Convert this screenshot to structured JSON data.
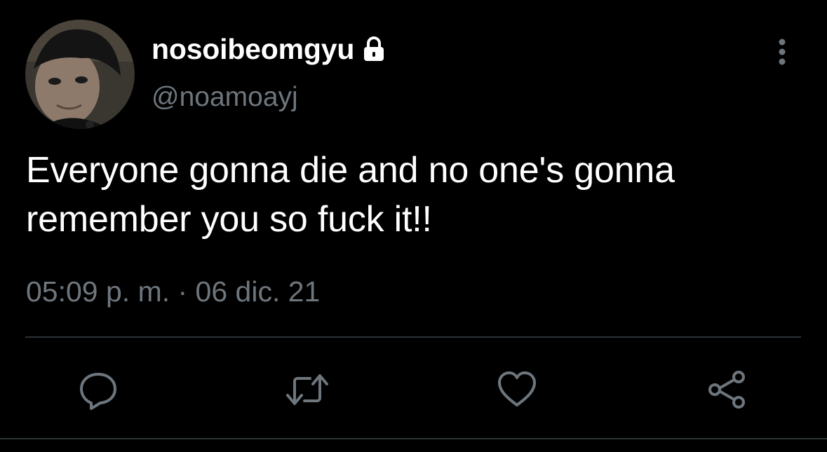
{
  "author": {
    "display_name": "nosoibeomgyu",
    "handle": "@noamoayj",
    "protected": true
  },
  "tweet": {
    "text": "Everyone gonna die and no one's gonna remember you so fuck it!!",
    "timestamp": "05:09 p. m. · 06 dic. 21"
  },
  "actions": {
    "reply_icon": "reply-icon",
    "retweet_icon": "retweet-icon",
    "like_icon": "heart-icon",
    "share_icon": "share-icon"
  },
  "colors": {
    "background": "#000000",
    "primary_text": "#ffffff",
    "secondary_text": "#6e767d",
    "divider": "#2f3336",
    "icon": "#6e767d"
  }
}
